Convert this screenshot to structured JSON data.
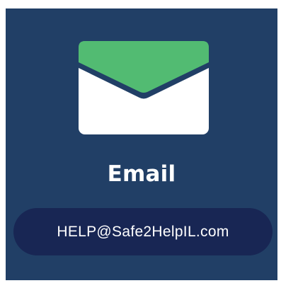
{
  "card": {
    "title": "Email",
    "icon": "envelope-icon",
    "email_address": "HELP@Safe2HelpIL.com"
  },
  "colors": {
    "background": "#213f66",
    "pill": "#182654",
    "envelope_flap": "#52bb72",
    "envelope_body": "#ffffff",
    "text": "#ffffff"
  }
}
